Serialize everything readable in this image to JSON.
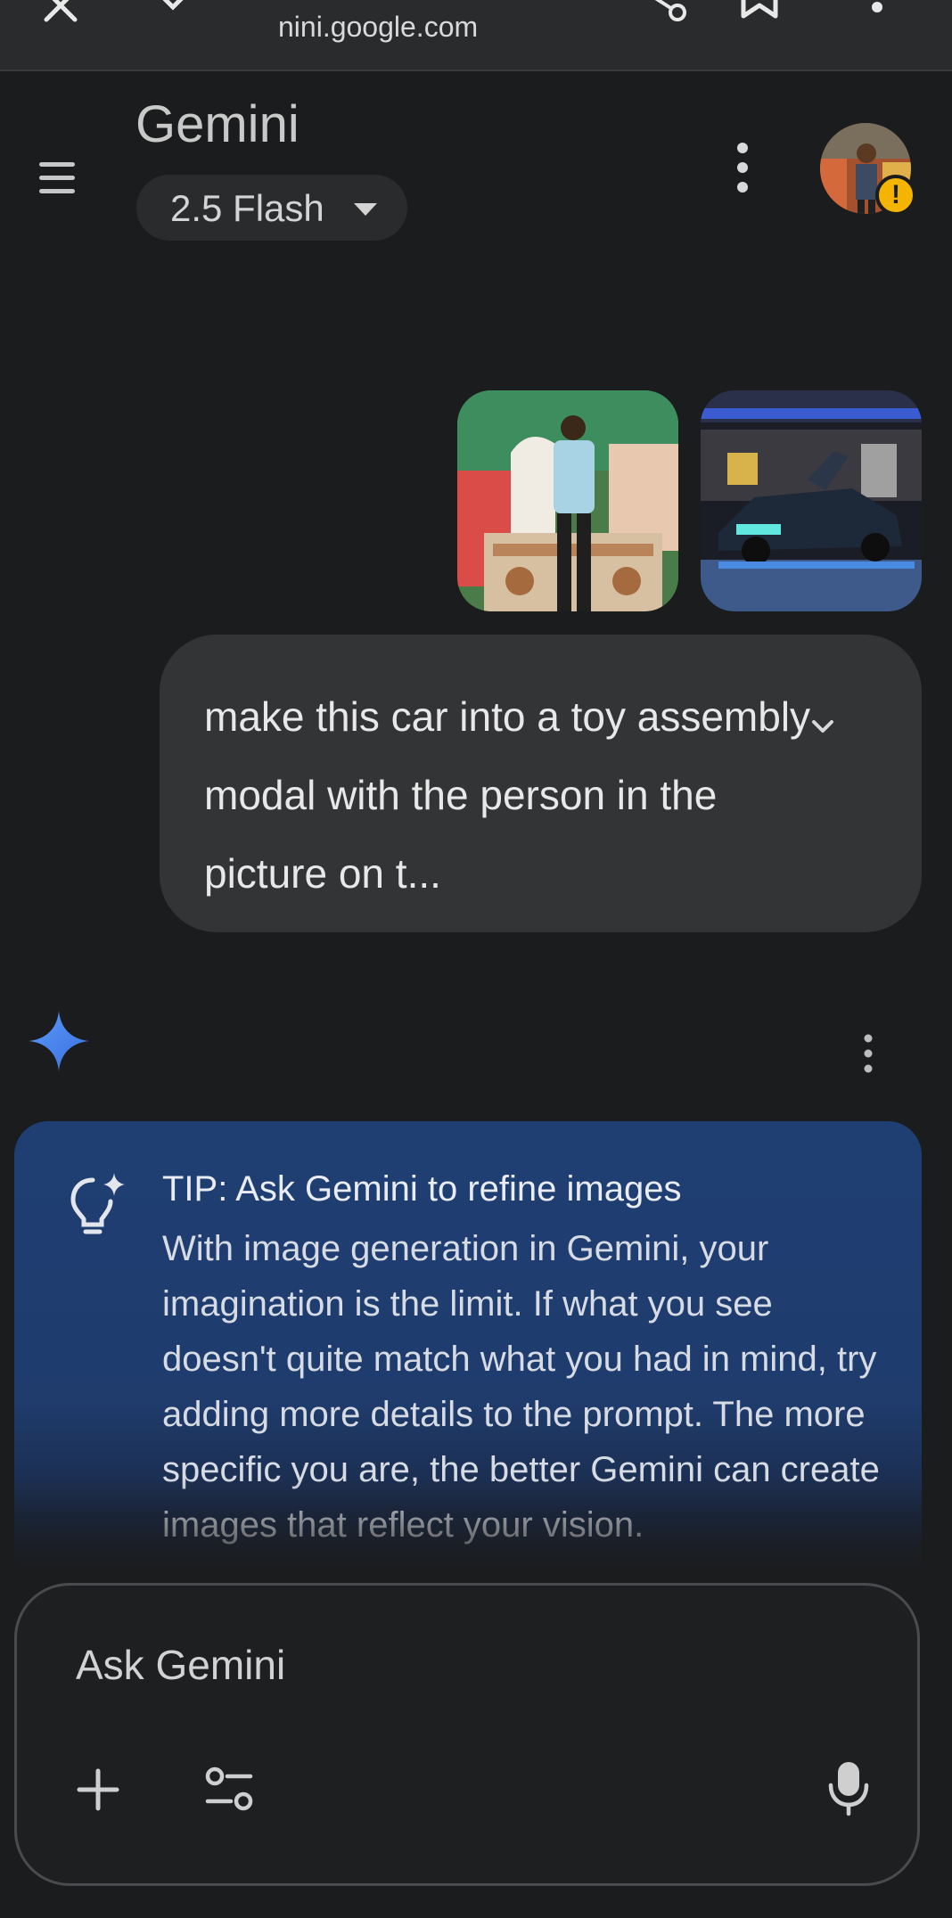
{
  "browser": {
    "url": "nini.google.com",
    "icons": [
      "close-icon",
      "chevron-down-icon",
      "share-icon",
      "bookmark-icon",
      "more-vert-icon"
    ]
  },
  "header": {
    "title": "Gemini",
    "model": "2.5 Flash",
    "icons": [
      "menu-icon",
      "more-vert-icon",
      "avatar",
      "warning-icon"
    ]
  },
  "conversation": {
    "attachments": [
      "person-photo",
      "car-photo"
    ],
    "user_message": "make this car into a toy assembly modal with the person in the picture on t...",
    "response": {
      "tip_title": "TIP: Ask Gemini to refine images",
      "tip_body": "With image generation in Gemini, your imagination is the limit. If what you see doesn't quite match what you had in mind, try adding more details to the prompt. The more specific you are, the better Gemini can create images that reflect your vision."
    }
  },
  "input": {
    "placeholder": "Ask Gemini",
    "icons": [
      "plus-icon",
      "tools-icon",
      "mic-icon"
    ]
  },
  "colors": {
    "background": "#1b1c1d",
    "bubble": "#333436",
    "tip_card": "#1f3e72",
    "spark": "#4a8af4",
    "warning": "#f4b400"
  }
}
